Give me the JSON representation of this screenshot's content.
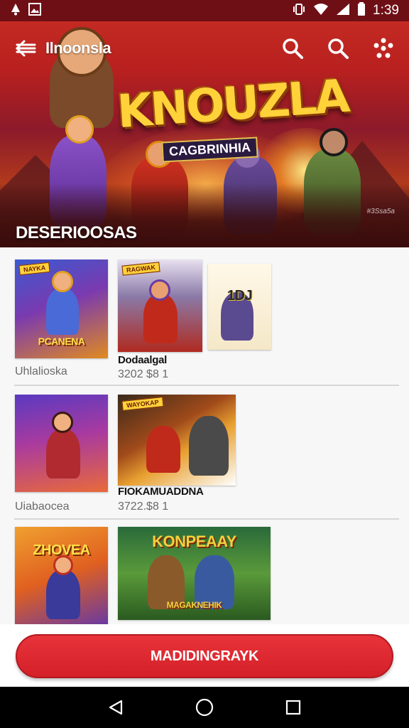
{
  "status_bar": {
    "time": "1:39",
    "icons": [
      "notification-icon",
      "image-icon",
      "vibrate-icon",
      "wifi-icon",
      "signal-icon",
      "battery-icon"
    ]
  },
  "toolbar": {
    "title": "Ilnoonsla",
    "icons": [
      "back-arrow-icon",
      "search-icon",
      "search-icon",
      "more-icon"
    ]
  },
  "hero": {
    "game_logo": "KNOUZLA",
    "game_subtitle": "CAGBRINHIA",
    "heading": "DESERIOOSAS",
    "credit": "#3Ssa5a"
  },
  "rows": [
    {
      "items": [
        {
          "badge": "NAYKA",
          "title": "PCANENA",
          "caption": "Uhlalioska"
        },
        {
          "badge": "RAGWAK",
          "title": "",
          "name": "Dodaalgal",
          "price": "3202 $8 1"
        },
        {
          "badge": "",
          "title": "1DJ"
        }
      ]
    },
    {
      "items": [
        {
          "badge": "",
          "title": "",
          "caption": "Uiabaocea"
        },
        {
          "badge": "WAYOKAP",
          "title": "",
          "name": "FIOKAMUADDNA",
          "price": "3722.$8 1"
        }
      ]
    },
    {
      "items": [
        {
          "badge": "",
          "title": "ZHOVEA"
        },
        {
          "badge": "",
          "title": "KONPEAAY",
          "subtitle": "MAGAKNEHIK"
        }
      ]
    }
  ],
  "cta": {
    "label": "MADIDINGRAYK"
  },
  "nav": {
    "icons": [
      "back-icon",
      "home-icon",
      "recents-icon"
    ]
  },
  "colors": {
    "status_bar": "#6e0f16",
    "accent": "#d42028",
    "divider": "#d6d6d6",
    "logo_gold": "#ffd23a"
  }
}
